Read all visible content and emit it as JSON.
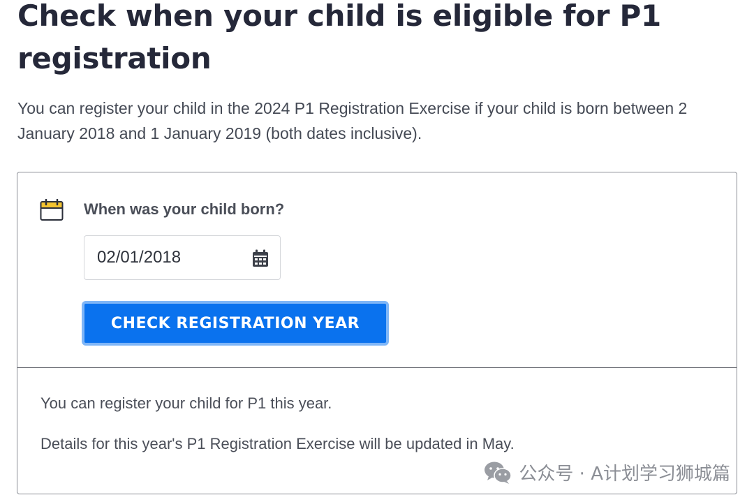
{
  "title": "Check when your child is eligible for P1 registration",
  "intro": "You can register your child in the 2024 P1 Registration Exercise if your child is born between 2 January 2018 and 1 January 2019 (both dates inclusive).",
  "form": {
    "question": "When was your child born?",
    "date_value": "02/01/2018",
    "button_label": "CHECK REGISTRATION YEAR"
  },
  "result": {
    "line1": "You can register your child for P1 this year.",
    "line2": "Details for this year's P1 Registration Exercise will be updated in May."
  },
  "watermark": {
    "text": "公众号 · A计划学习狮城篇"
  },
  "colors": {
    "accent": "#0a72ee",
    "calendar_icon": "#f4c430"
  },
  "icons": [
    "calendar-icon",
    "date-picker-icon",
    "wechat-icon"
  ]
}
